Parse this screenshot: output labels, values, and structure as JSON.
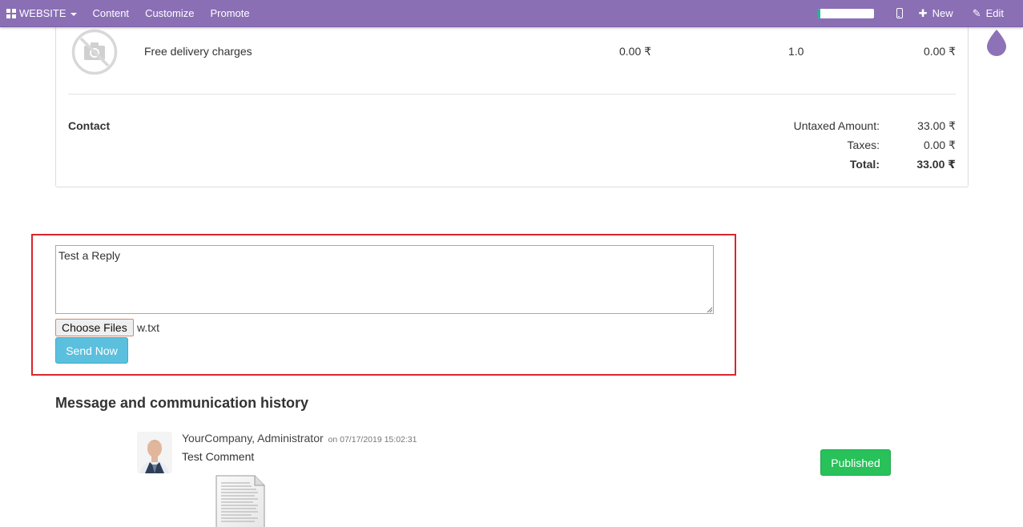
{
  "navbar": {
    "website_label": "WEBSITE",
    "items": [
      "Content",
      "Customize",
      "Promote"
    ],
    "progress_fraction": 0.05,
    "new_label": "New",
    "edit_label": "Edit",
    "bg_color": "#8a6fb5"
  },
  "order_line": {
    "product": "Free delivery charges",
    "unit_price": "0.00 ₹",
    "quantity": "1.0",
    "subtotal": "0.00 ₹"
  },
  "contact_label": "Contact",
  "totals": {
    "untaxed_label": "Untaxed Amount:",
    "untaxed_value": "33.00 ₹",
    "taxes_label": "Taxes:",
    "taxes_value": "0.00 ₹",
    "total_label": "Total:",
    "total_value": "33.00 ₹"
  },
  "reply": {
    "text": "Test a Reply",
    "choose_files_label": "Choose Files",
    "file_name": "w.txt",
    "send_label": "Send Now",
    "highlight_color": "#d9262c"
  },
  "history": {
    "title": "Message and communication history",
    "messages": [
      {
        "author": "YourCompany, Administrator",
        "date": "on 07/17/2019 15:02:31",
        "body": "Test Comment",
        "status": "Published",
        "attachment_icon": "text-file-icon"
      }
    ]
  },
  "icons": {
    "apps": "grid-icon",
    "mobile": "mobile-preview-icon",
    "new": "plus-icon",
    "edit": "pencil-icon",
    "droplet": "theme-droplet-icon",
    "product_image": "no-image-camera-icon",
    "avatar": "user-avatar"
  }
}
